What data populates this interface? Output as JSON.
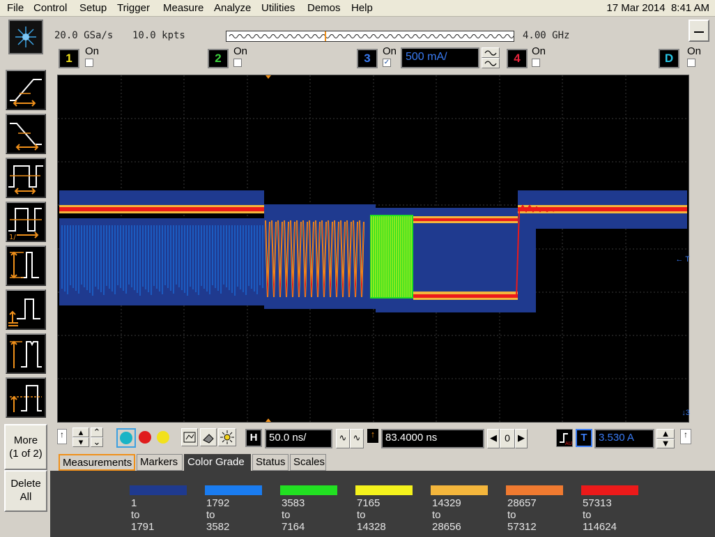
{
  "menu": {
    "items": [
      "File",
      "Control",
      "Setup",
      "Trigger",
      "Measure",
      "Analyze",
      "Utilities",
      "Demos",
      "Help"
    ],
    "date": "17 Mar 2014",
    "time": "8:41 AM"
  },
  "acquisition": {
    "sample_rate": "20.0 GSa/s",
    "memory_depth": "10.0 kpts",
    "bandwidth": "4.00 GHz"
  },
  "channels": [
    {
      "number": "1",
      "label": "On",
      "checked": false,
      "color": "#f2e31c"
    },
    {
      "number": "2",
      "label": "On",
      "checked": false,
      "color": "#3cd23c"
    },
    {
      "number": "3",
      "label": "On",
      "checked": true,
      "color": "#3a7cf5",
      "scale": "500 mA/"
    },
    {
      "number": "4",
      "label": "On",
      "checked": false,
      "color": "#e8243c"
    },
    {
      "number": "D",
      "label": "On",
      "checked": false,
      "color": "#27c6e6"
    }
  ],
  "sidebar": {
    "more_label": "More",
    "more_page": "(1 of 2)",
    "delete_label": "Delete",
    "delete_sub": "All",
    "tool_icons": [
      "rise-time-icon",
      "fall-time-icon",
      "pulse-width-icon",
      "duty-cycle-icon",
      "amplitude-icon",
      "base-level-icon",
      "top-level-icon",
      "middle-level-icon"
    ]
  },
  "screen": {
    "trigger_marker_label": "T",
    "channel3_marker_label": "3"
  },
  "horizontal": {
    "scale_label": "H",
    "scale": "50.0 ns/",
    "position": "83.4000 ns",
    "ref_value": "0"
  },
  "trigger": {
    "label": "T",
    "level": "3.530 A"
  },
  "tabs": [
    {
      "label": "Measurements",
      "state": "focused"
    },
    {
      "label": "Markers",
      "state": "normal"
    },
    {
      "label": "Color Grade",
      "state": "active"
    },
    {
      "label": "Status",
      "state": "normal"
    },
    {
      "label": "Scales",
      "state": "normal"
    }
  ],
  "color_grade": {
    "bins": [
      {
        "color": "#1f3a8f",
        "from": "1",
        "to_word": "to",
        "to": "1791"
      },
      {
        "color": "#1a7cf0",
        "from": "1792",
        "to_word": "to",
        "to": "3582"
      },
      {
        "color": "#22e022",
        "from": "3583",
        "to_word": "to",
        "to": "7164"
      },
      {
        "color": "#f4f21c",
        "from": "7165",
        "to_word": "to",
        "to": "14328"
      },
      {
        "color": "#f4b63c",
        "from": "14329",
        "to_word": "to",
        "to": "28656"
      },
      {
        "color": "#f07a30",
        "from": "28657",
        "to_word": "to",
        "to": "57312"
      },
      {
        "color": "#ec1a1a",
        "from": "57313",
        "to_word": "to",
        "to": "114624"
      }
    ]
  }
}
